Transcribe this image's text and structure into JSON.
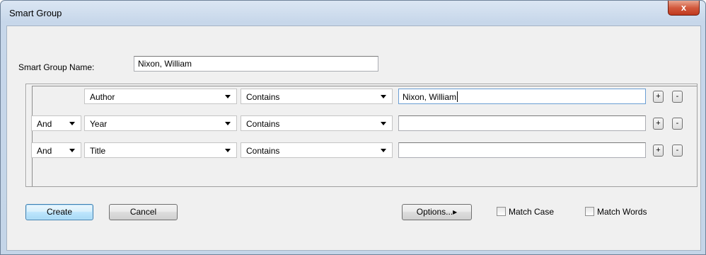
{
  "window": {
    "title": "Smart Group",
    "close_glyph": "x"
  },
  "name_field": {
    "label": "Smart Group Name:",
    "value": "Nixon, William"
  },
  "rows": [
    {
      "connector": "",
      "field": "Author",
      "operator": "Contains",
      "value": "Nixon, William",
      "add": "+",
      "remove": "-"
    },
    {
      "connector": "And",
      "field": "Year",
      "operator": "Contains",
      "value": "",
      "add": "+",
      "remove": "-"
    },
    {
      "connector": "And",
      "field": "Title",
      "operator": "Contains",
      "value": "",
      "add": "+",
      "remove": "-"
    }
  ],
  "buttons": {
    "create": "Create",
    "cancel": "Cancel",
    "options": "Options...▸"
  },
  "checkboxes": {
    "match_case": "Match Case",
    "match_words": "Match Words"
  }
}
